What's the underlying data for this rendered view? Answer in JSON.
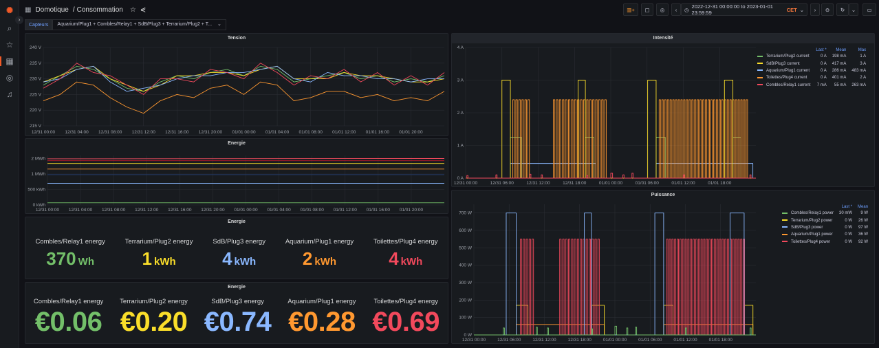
{
  "nav": {
    "breadcrumb_folder": "Domotique",
    "breadcrumb_sep": "/",
    "dashboard_title": "Consommation"
  },
  "toolbar": {
    "time_range": "2022-12-31 00:00:00 to 2023-01-01 23:59:59",
    "timezone": "CET"
  },
  "variable": {
    "label": "Capteurs",
    "value": "Aquarium/Plug1 + Combles/Relay1 + SdB/Plug3 + Terrarium/Plug2 + T..."
  },
  "colors": {
    "green": "#73bf69",
    "yellow": "#fade2a",
    "blue": "#8ab8ff",
    "orange": "#ff9830",
    "red": "#f2495c"
  },
  "panels": {
    "tension": {
      "title": "Tension"
    },
    "energie_graph": {
      "title": "Energie"
    },
    "energie_stat": {
      "title": "Energie",
      "items": [
        {
          "name": "Combles/Relay1 energy",
          "value": "370",
          "unit": "Wh",
          "color": "#73bf69"
        },
        {
          "name": "Terrarium/Plug2 energy",
          "value": "1",
          "unit": "kWh",
          "color": "#fade2a"
        },
        {
          "name": "SdB/Plug3 energy",
          "value": "4",
          "unit": "kWh",
          "color": "#8ab8ff"
        },
        {
          "name": "Aquarium/Plug1 energy",
          "value": "2",
          "unit": "kWh",
          "color": "#ff9830"
        },
        {
          "name": "Toilettes/Plug4 energy",
          "value": "4",
          "unit": "kWh",
          "color": "#f2495c"
        }
      ]
    },
    "energie_cost": {
      "title": "Energie",
      "items": [
        {
          "name": "Combles/Relay1 energy",
          "value": "€0.06",
          "color": "#73bf69"
        },
        {
          "name": "Terrarium/Plug2 energy",
          "value": "€0.20",
          "color": "#fade2a"
        },
        {
          "name": "SdB/Plug3 energy",
          "value": "€0.74",
          "color": "#8ab8ff"
        },
        {
          "name": "Aquarium/Plug1 energy",
          "value": "€0.28",
          "color": "#ff9830"
        },
        {
          "name": "Toilettes/Plug4 energy",
          "value": "€0.69",
          "color": "#f2495c"
        }
      ]
    },
    "intensite": {
      "title": "Intensité",
      "legend_headers": [
        "Last *",
        "Mean",
        "Max"
      ],
      "legend": [
        {
          "name": "Terrarium/Plug2 current",
          "color": "#73bf69",
          "last": "0 A",
          "mean": "198 mA",
          "max": "1 A"
        },
        {
          "name": "SdB/Plug3 current",
          "color": "#fade2a",
          "last": "0 A",
          "mean": "417 mA",
          "max": "3 A"
        },
        {
          "name": "Aquarium/Plug1 current",
          "color": "#8ab8ff",
          "last": "0 A",
          "mean": "286 mA",
          "max": "483 mA"
        },
        {
          "name": "Toilettes/Plug4 current",
          "color": "#ff9830",
          "last": "0 A",
          "mean": "401 mA",
          "max": "2 A"
        },
        {
          "name": "Combles/Relay1 current",
          "color": "#f2495c",
          "last": "7 mA",
          "mean": "55 mA",
          "max": "263 mA"
        }
      ]
    },
    "puissance": {
      "title": "Puissance",
      "legend_headers": [
        "Last *",
        "Mean"
      ],
      "legend": [
        {
          "name": "Combles/Relay1 power",
          "color": "#73bf69",
          "last": "30 mW",
          "mean": "9 W"
        },
        {
          "name": "Terrarium/Plug2 power",
          "color": "#fade2a",
          "last": "0 W",
          "mean": "26 W"
        },
        {
          "name": "SdB/Plug3 power",
          "color": "#8ab8ff",
          "last": "0 W",
          "mean": "97 W"
        },
        {
          "name": "Aquarium/Plug1 power",
          "color": "#ff9830",
          "last": "0 W",
          "mean": "36 W"
        },
        {
          "name": "Toilettes/Plug4 power",
          "color": "#f2495c",
          "last": "0 W",
          "mean": "92 W"
        }
      ]
    }
  },
  "chart_data": [
    {
      "id": "tension",
      "type": "line",
      "x_unit": "hours since 12/31 00:00",
      "ylim": [
        215,
        240
      ],
      "yticks": [
        [
          215,
          "215 V"
        ],
        [
          220,
          "220 V"
        ],
        [
          225,
          "225 V"
        ],
        [
          230,
          "230 V"
        ],
        [
          235,
          "235 V"
        ],
        [
          240,
          "240 V"
        ]
      ],
      "xticks": [
        [
          0,
          "12/31 00:00"
        ],
        [
          4,
          "12/31 04:00"
        ],
        [
          8,
          "12/31 08:00"
        ],
        [
          12,
          "12/31 12:00"
        ],
        [
          16,
          "12/31 16:00"
        ],
        [
          20,
          "12/31 20:00"
        ],
        [
          24,
          "01/01 00:00"
        ],
        [
          28,
          "01/01 04:00"
        ],
        [
          32,
          "01/01 08:00"
        ],
        [
          36,
          "01/01 12:00"
        ],
        [
          40,
          "01/01 16:00"
        ],
        [
          44,
          "01/01 20:00"
        ]
      ],
      "step": 2,
      "series": [
        {
          "color": "#73bf69",
          "values": [
            228,
            231,
            234,
            233,
            230,
            227,
            226,
            229,
            231,
            230,
            232,
            233,
            231,
            234,
            233,
            229,
            230,
            231,
            232,
            230,
            231,
            229,
            230,
            229,
            231
          ]
        },
        {
          "color": "#fade2a",
          "values": [
            229,
            231,
            233,
            234,
            230,
            228,
            226,
            228,
            231,
            231,
            232,
            232,
            231,
            233,
            234,
            230,
            230,
            230,
            232,
            231,
            231,
            230,
            229,
            229,
            230
          ]
        },
        {
          "color": "#8ab8ff",
          "values": [
            229,
            230,
            233,
            234,
            229,
            226,
            227,
            228,
            230,
            231,
            231,
            232,
            232,
            233,
            234,
            230,
            229,
            232,
            231,
            231,
            230,
            230,
            229,
            230,
            230
          ]
        },
        {
          "color": "#f2495c",
          "values": [
            227,
            230,
            235,
            232,
            231,
            228,
            225,
            230,
            230,
            229,
            233,
            232,
            230,
            235,
            232,
            228,
            231,
            230,
            233,
            229,
            232,
            228,
            231,
            228,
            232
          ]
        },
        {
          "color": "#ff9830",
          "values": [
            223,
            225,
            229,
            228,
            224,
            221,
            219,
            223,
            225,
            224,
            227,
            228,
            225,
            229,
            228,
            223,
            224,
            226,
            226,
            224,
            225,
            223,
            224,
            223,
            226
          ]
        }
      ]
    },
    {
      "id": "energie",
      "type": "line",
      "ylim": [
        0,
        1.6
      ],
      "y_unit": "MWh",
      "yticks": [
        [
          0,
          "0 kWh"
        ],
        [
          0.5,
          "500 kWh"
        ],
        [
          1,
          "1 MWh"
        ],
        [
          1.5,
          "2 MWh"
        ]
      ],
      "xticks": [
        [
          0,
          "12/31 00:00"
        ],
        [
          4,
          "12/31 04:00"
        ],
        [
          8,
          "12/31 08:00"
        ],
        [
          12,
          "12/31 12:00"
        ],
        [
          16,
          "12/31 16:00"
        ],
        [
          20,
          "12/31 20:00"
        ],
        [
          24,
          "01/01 00:00"
        ],
        [
          28,
          "01/01 04:00"
        ],
        [
          32,
          "01/01 08:00"
        ],
        [
          36,
          "01/01 12:00"
        ],
        [
          40,
          "01/01 16:00"
        ],
        [
          44,
          "01/01 20:00"
        ]
      ],
      "series": [
        {
          "color": "#f2495c",
          "values": [
            1.49,
            1.5
          ]
        },
        {
          "color": "#c4162a",
          "values": [
            1.43,
            1.43
          ]
        },
        {
          "color": "#fade2a",
          "values": [
            1.34,
            1.34
          ]
        },
        {
          "color": "#ff9830",
          "values": [
            1.16,
            1.16
          ]
        },
        {
          "color": "#1f3b70",
          "values": [
            0.98,
            0.98
          ]
        },
        {
          "color": "#8ab8ff",
          "values": [
            0.7,
            0.7
          ]
        },
        {
          "color": "#73bf69",
          "values": [
            0.07,
            0.07
          ]
        }
      ]
    },
    {
      "id": "intensite",
      "type": "line",
      "ylim": [
        0,
        4
      ],
      "yticks": [
        [
          0,
          "0 A"
        ],
        [
          1,
          "1 A"
        ],
        [
          2,
          "2 A"
        ],
        [
          3,
          "3 A"
        ],
        [
          4,
          "4 A"
        ]
      ],
      "xticks": [
        [
          0,
          "12/31 00:00"
        ],
        [
          6,
          "12/31 06:00"
        ],
        [
          12,
          "12/31 12:00"
        ],
        [
          18,
          "12/31 18:00"
        ],
        [
          24,
          "01/01 00:00"
        ],
        [
          30,
          "01/01 06:00"
        ],
        [
          36,
          "01/01 12:00"
        ],
        [
          42,
          "01/01 18:00"
        ]
      ],
      "series": [
        {
          "name": "Aquarium/Plug1 current",
          "color": "#8ab8ff",
          "segments": [
            [
              7.4,
              21.5,
              0.45
            ],
            [
              31.5,
              47.5,
              0.45
            ]
          ]
        },
        {
          "name": "Terrarium/Plug2 current",
          "color": "#73bf69",
          "segments": [
            [
              7.4,
              9.2,
              1.25
            ],
            [
              19.8,
              21.2,
              1.25
            ],
            [
              31.5,
              33,
              1.25
            ],
            [
              44.2,
              45.5,
              1.25
            ]
          ]
        },
        {
          "name": "Toilettes/Plug4 current",
          "color": "#ff9830",
          "pulses": [
            [
              7.8,
              10.6,
              2.4,
              0.5
            ],
            [
              14.5,
              23.5,
              2.4,
              0.5
            ],
            [
              32,
              46.5,
              2.4,
              0.45
            ]
          ]
        },
        {
          "name": "SdB/Plug3 current",
          "color": "#fade2a",
          "segments": [
            [
              6,
              7.4,
              3
            ],
            [
              18.6,
              19.8,
              3
            ],
            [
              30.1,
              31.5,
              3
            ],
            [
              42.8,
              44.2,
              3
            ]
          ]
        },
        {
          "name": "Combles/Relay1 current",
          "color": "#f2495c",
          "segments": [
            [
              0.2,
              0.4,
              0.08
            ],
            [
              5,
              5.2,
              0.1
            ],
            [
              10.6,
              10.8,
              0.12
            ],
            [
              12.5,
              12.7,
              0.1
            ],
            [
              20,
              20.2,
              0.08
            ],
            [
              24,
              24.3,
              0.15
            ],
            [
              26,
              26.2,
              0.1
            ],
            [
              27.5,
              27.7,
              0.15
            ],
            [
              36,
              36.2,
              0.1
            ],
            [
              47,
              47.2,
              0.1
            ]
          ]
        }
      ]
    },
    {
      "id": "puissance",
      "type": "line",
      "ylim": [
        0,
        750
      ],
      "yticks": [
        [
          0,
          "0 W"
        ],
        [
          100,
          "100 W"
        ],
        [
          200,
          "200 W"
        ],
        [
          300,
          "300 W"
        ],
        [
          400,
          "400 W"
        ],
        [
          500,
          "500 W"
        ],
        [
          600,
          "600 W"
        ],
        [
          700,
          "700 W"
        ]
      ],
      "xticks": [
        [
          0,
          "12/31 00:00"
        ],
        [
          6,
          "12/31 06:00"
        ],
        [
          12,
          "12/31 12:00"
        ],
        [
          18,
          "12/31 18:00"
        ],
        [
          24,
          "01/01 00:00"
        ],
        [
          30,
          "01/01 06:00"
        ],
        [
          36,
          "01/01 12:00"
        ],
        [
          42,
          "01/01 18:00"
        ]
      ],
      "series": [
        {
          "name": "Aquarium/Plug1 power",
          "color": "#ff9830",
          "segments": [
            [
              7.2,
              22.2,
              60
            ],
            [
              32.3,
              47.5,
              60
            ]
          ]
        },
        {
          "name": "Terrarium/Plug2 power",
          "color": "#fade2a",
          "segments": [
            [
              7.2,
              9.2,
              170
            ],
            [
              20,
              22.2,
              170
            ],
            [
              32.3,
              33.9,
              170
            ],
            [
              46,
              47.5,
              170
            ]
          ]
        },
        {
          "name": "Toilettes/Plug4 power",
          "color": "#f2495c",
          "pulses": [
            [
              7.9,
              10.3,
              550,
              0.5
            ],
            [
              14.6,
              21.6,
              550,
              0.5
            ],
            [
              32.8,
              46,
              550,
              0.45
            ]
          ]
        },
        {
          "name": "SdB/Plug3 power",
          "color": "#8ab8ff",
          "segments": [
            [
              5.5,
              7.2,
              700
            ],
            [
              18.8,
              20,
              700
            ],
            [
              30.8,
              32.3,
              700
            ],
            [
              43.6,
              46,
              700
            ]
          ]
        },
        {
          "name": "Combles/Relay1 power",
          "color": "#73bf69",
          "segments": [
            [
              5,
              5.2,
              40
            ],
            [
              10.6,
              10.8,
              45
            ],
            [
              12.5,
              12.7,
              40
            ],
            [
              20,
              20.2,
              35
            ],
            [
              24,
              24.3,
              50
            ],
            [
              26,
              26.2,
              40
            ],
            [
              27.5,
              27.7,
              45
            ],
            [
              36,
              36.2,
              40
            ],
            [
              47,
              47.2,
              40
            ]
          ]
        }
      ]
    }
  ]
}
